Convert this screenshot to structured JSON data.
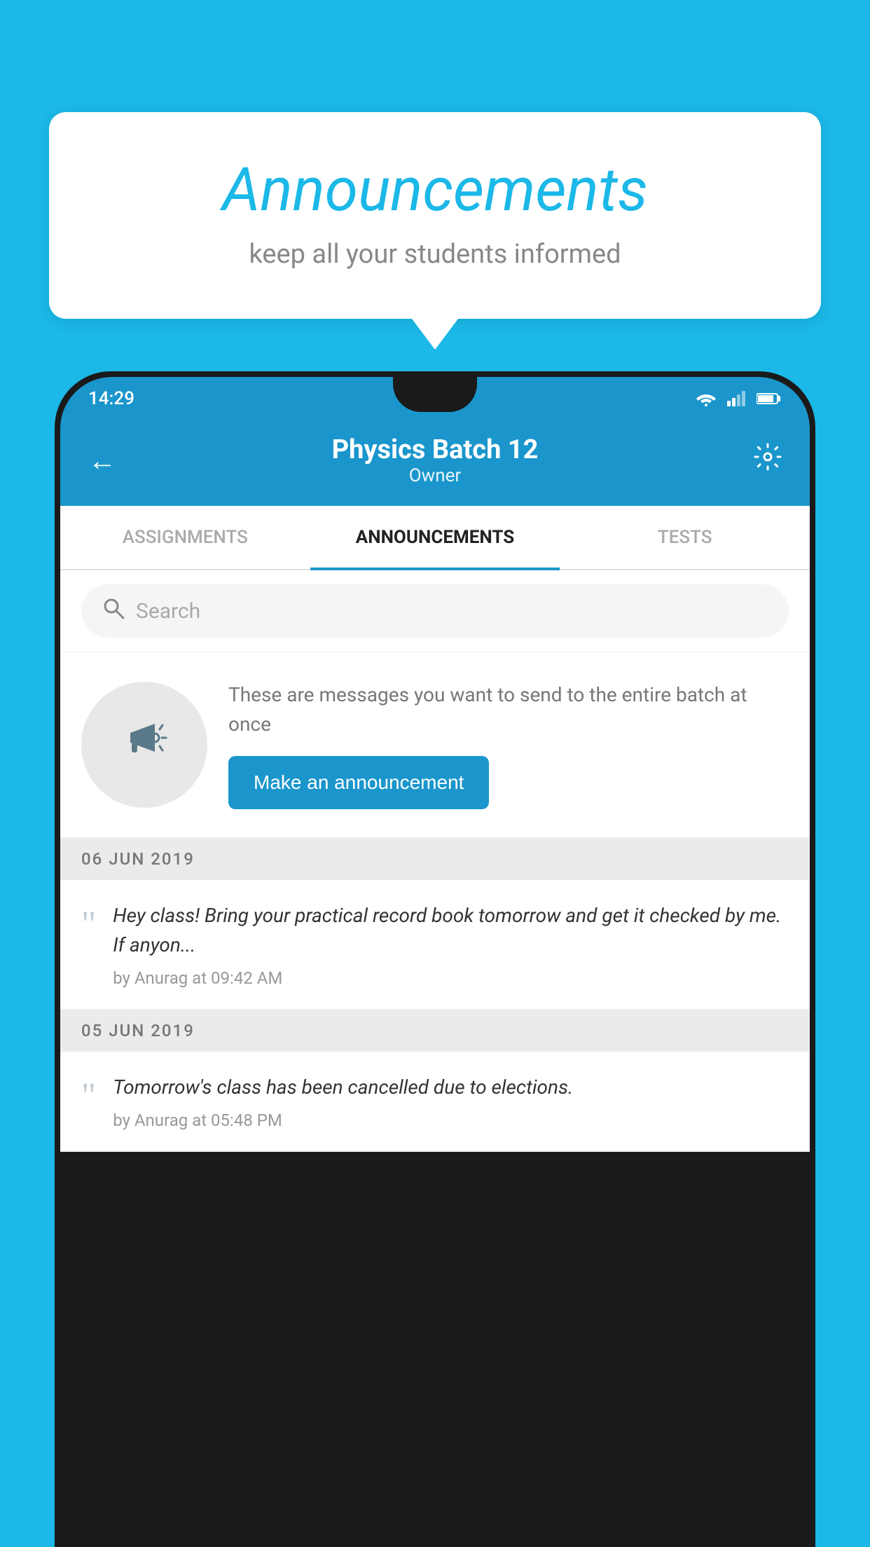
{
  "page": {
    "background_color": "#1bb8e8"
  },
  "speech_bubble": {
    "title": "Announcements",
    "subtitle": "keep all your students informed"
  },
  "status_bar": {
    "time": "14:29"
  },
  "header": {
    "title": "Physics Batch 12",
    "subtitle": "Owner",
    "back_label": "←",
    "settings_label": "⚙"
  },
  "tabs": [
    {
      "label": "ASSIGNMENTS",
      "active": false
    },
    {
      "label": "ANNOUNCEMENTS",
      "active": true
    },
    {
      "label": "TESTS",
      "active": false
    }
  ],
  "search": {
    "placeholder": "Search"
  },
  "announcement_prompt": {
    "description": "These are messages you want to send to the entire batch at once",
    "button_label": "Make an announcement"
  },
  "date_sections": [
    {
      "date": "06  JUN  2019",
      "items": [
        {
          "text": "Hey class! Bring your practical record book tomorrow and get it checked by me. If anyon...",
          "meta": "by Anurag at 09:42 AM"
        }
      ]
    },
    {
      "date": "05  JUN  2019",
      "items": [
        {
          "text": "Tomorrow's class has been cancelled due to elections.",
          "meta": "by Anurag at 05:48 PM"
        }
      ]
    }
  ]
}
